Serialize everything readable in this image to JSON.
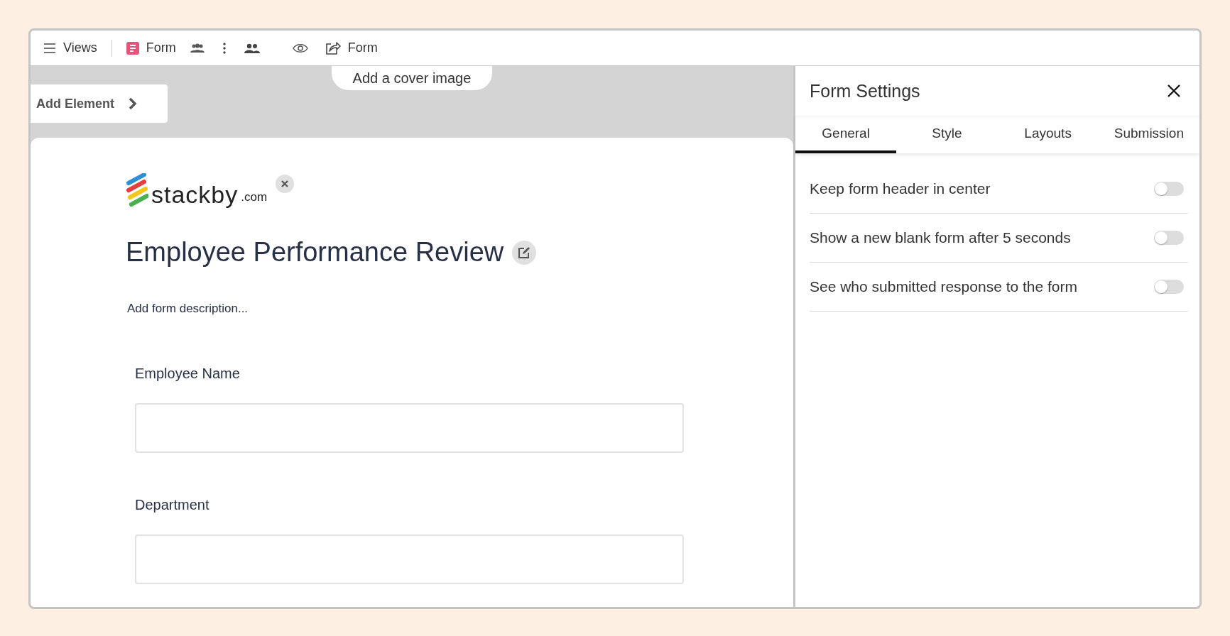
{
  "toolbar": {
    "views_label": "Views",
    "view_name": "Form",
    "share_label": "Form"
  },
  "canvas": {
    "cover_button": "Add a cover image",
    "add_element_button": "Add Element"
  },
  "form": {
    "logo_text": "stackby",
    "logo_suffix": ".com",
    "title": "Employee Performance Review",
    "description_placeholder": "Add form description...",
    "fields": [
      {
        "label": "Employee Name"
      },
      {
        "label": "Department"
      }
    ]
  },
  "settings_panel": {
    "title": "Form Settings",
    "tabs": [
      {
        "label": "General",
        "selected": true
      },
      {
        "label": "Style",
        "selected": false
      },
      {
        "label": "Layouts",
        "selected": false
      },
      {
        "label": "Submission",
        "selected": false
      }
    ],
    "options": [
      {
        "label": "Keep form header in center",
        "on": false
      },
      {
        "label": "Show a new blank form after 5 seconds",
        "on": false
      },
      {
        "label": "See who submitted response to the form",
        "on": false
      }
    ]
  }
}
